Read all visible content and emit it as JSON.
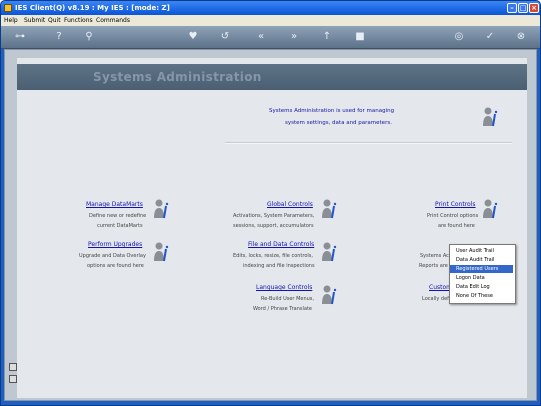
{
  "window": {
    "title": "IES Client(Q) v8.19 : My IES :      [mode: Z]"
  },
  "menu": [
    "Help",
    "Submit",
    "Quit",
    "Functions",
    "Commands"
  ],
  "toolbar_icons": [
    "key-icon",
    "help-icon",
    "search-icon",
    "heart-icon",
    "back-icon",
    "rewind-icon",
    "forward-icon",
    "up-icon",
    "stop-icon",
    "refresh-icon",
    "ok-icon",
    "close-icon"
  ],
  "banner_title": "Systems Administration",
  "info": {
    "line1": "Systems Administration is used for managing",
    "line2": "system settings, data and parameters."
  },
  "modules": {
    "manage_datamarts": {
      "title": "Manage DataMarts",
      "desc1": "Define new or redefine",
      "desc2": "current DataMarts"
    },
    "perform_upgrades": {
      "title": "Perform Upgrades",
      "desc1": "Upgrade and Data Overlay",
      "desc2": "options are found here"
    },
    "global_controls": {
      "title": "Global Controls",
      "desc1": "Activations, System Parameters,",
      "desc2": "sessions, support, accumulators"
    },
    "file_data_controls": {
      "title": "File and Data Controls",
      "desc1": "Edits, locks, resize, file controls,",
      "desc2": "indexing and file inspections"
    },
    "language_controls": {
      "title": "Language Controls",
      "desc1": "Re-Build User Menus,",
      "desc2": "Word / Phrase Translate"
    },
    "print_controls": {
      "title": "Print Controls",
      "desc1": "Print Control options",
      "desc2": "are found here"
    },
    "systems_audit": {
      "desc1": "Systems Ac",
      "desc2": "Reports are"
    },
    "customization": {
      "title": "Custom",
      "desc1": "Locally defi"
    }
  },
  "popup": {
    "items": [
      "User Audit Trail",
      "Data Audit Trail",
      "Registered Users",
      "Logon Data",
      "Data Edit Log",
      "None Of These"
    ],
    "selected_index": 2
  }
}
